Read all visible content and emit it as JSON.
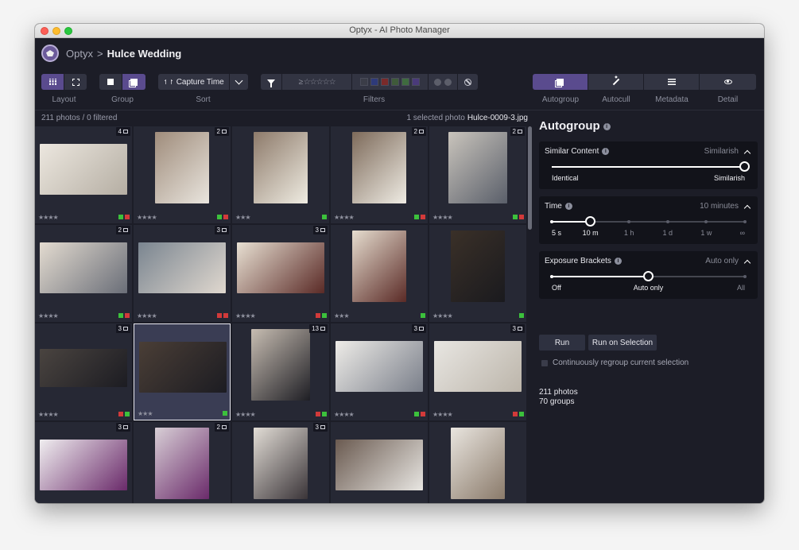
{
  "window": {
    "title": "Optyx - AI Photo Manager"
  },
  "breadcrumb": {
    "app": "Optyx",
    "separator": ">",
    "project": "Hulce Wedding"
  },
  "toolbar": {
    "layout_label": "Layout",
    "group_label": "Group",
    "sort_label": "Sort",
    "sort_value": "Capture Time",
    "sort_icon": "↿↾",
    "filters_label": "Filters",
    "filter_stars": "≥ ☆☆☆☆☆",
    "filter_colors": [
      "#3b3d48",
      "#2e3a7a",
      "#7a2a2a",
      "#3f5a3a",
      "#3f6b3f",
      "#4a3a7a"
    ],
    "autogroup_label": "Autogroup",
    "autocull_label": "Autocull",
    "metadata_label": "Metadata",
    "detail_label": "Detail"
  },
  "info": {
    "count": "211 photos / 0 filtered",
    "selected_prefix": "1 selected photo",
    "selected_file": "Hulce-0009-3.jpg"
  },
  "photos": [
    {
      "badge": "4",
      "stars": "★★★★",
      "flags": [
        "#3cc13c",
        "#d23a3a"
      ],
      "colors": [
        "#ece7df",
        "#b5aea3"
      ]
    },
    {
      "badge": "2",
      "stars": "★★★★",
      "flags": [
        "#3cc13c",
        "#d23a3a"
      ],
      "colors": [
        "#9f8c7b",
        "#e9e5de"
      ]
    },
    {
      "badge": "",
      "stars": "★★★",
      "flags": [
        "#3cc13c"
      ],
      "colors": [
        "#8d7a6a",
        "#efece2"
      ]
    },
    {
      "badge": "2",
      "stars": "★★★★",
      "flags": [
        "#3cc13c",
        "#d23a3a"
      ],
      "colors": [
        "#7d6a5a",
        "#efece4"
      ]
    },
    {
      "badge": "2",
      "stars": "★★★★",
      "flags": [
        "#3cc13c",
        "#d23a3a"
      ],
      "colors": [
        "#c9c4bc",
        "#5a5f6a"
      ]
    },
    {
      "badge": "2",
      "stars": "★★★★",
      "flags": [
        "#3cc13c",
        "#d23a3a"
      ],
      "colors": [
        "#e3dbd0",
        "#6a6e78"
      ]
    },
    {
      "badge": "3",
      "stars": "★★★★",
      "flags": [
        "#d23a3a",
        "#d23a3a"
      ],
      "colors": [
        "#7a8590",
        "#e0d8cf"
      ]
    },
    {
      "badge": "3",
      "stars": "★★★★",
      "flags": [
        "#d23a3a",
        "#3cc13c"
      ],
      "colors": [
        "#e8e0d3",
        "#5a2a26"
      ]
    },
    {
      "badge": "",
      "stars": "★★★",
      "flags": [
        "#3cc13c"
      ],
      "colors": [
        "#e6ddcf",
        "#5a2a26"
      ]
    },
    {
      "badge": "",
      "stars": "★★★★",
      "flags": [
        "#3cc13c"
      ],
      "colors": [
        "#3a3028",
        "#1a1a1e"
      ]
    },
    {
      "badge": "3",
      "stars": "★★★★",
      "flags": [
        "#d23a3a",
        "#3cc13c"
      ],
      "colors": [
        "#4a4440",
        "#1c1c22"
      ]
    },
    {
      "badge": "",
      "stars": "★★★",
      "flags": [
        "#3cc13c"
      ],
      "colors": [
        "#4a3e36",
        "#1c1c22"
      ]
    },
    {
      "badge": "13",
      "stars": "★★★★",
      "flags": [
        "#d23a3a",
        "#3cc13c"
      ],
      "colors": [
        "#c7bdb2",
        "#1e1e24"
      ]
    },
    {
      "badge": "3",
      "stars": "★★★★",
      "flags": [
        "#3cc13c",
        "#d23a3a"
      ],
      "colors": [
        "#eeece8",
        "#7a7f8a"
      ]
    },
    {
      "badge": "3",
      "stars": "★★★★",
      "flags": [
        "#d23a3a",
        "#3cc13c"
      ],
      "colors": [
        "#e8e6e2",
        "#bcb5aa"
      ]
    },
    {
      "badge": "3",
      "stars": "",
      "flags": [],
      "colors": [
        "#f0eef0",
        "#6a2a6a"
      ]
    },
    {
      "badge": "2",
      "stars": "",
      "flags": [],
      "colors": [
        "#d8cfd6",
        "#6a2a6a"
      ]
    },
    {
      "badge": "3",
      "stars": "",
      "flags": [],
      "colors": [
        "#e2ddd6",
        "#3a3438"
      ]
    },
    {
      "badge": "",
      "stars": "",
      "flags": [],
      "colors": [
        "#6a5a50",
        "#e8e6e2"
      ]
    },
    {
      "badge": "",
      "stars": "",
      "flags": [],
      "colors": [
        "#e9e5df",
        "#8a7a6a"
      ]
    }
  ],
  "selected_index": 11,
  "panel": {
    "title": "Autogroup",
    "similar": {
      "label": "Similar Content",
      "value": "Similarish",
      "left": "Identical",
      "right": "Similarish",
      "level": 1.0
    },
    "time": {
      "label": "Time",
      "value": "10 minutes",
      "ticks": [
        "5 s",
        "10 m",
        "1 h",
        "1 d",
        "1 w",
        "∞"
      ],
      "selected": 1
    },
    "exposure": {
      "label": "Exposure Brackets",
      "value": "Auto only",
      "ticks": [
        "Off",
        "Auto only",
        "All"
      ],
      "selected": 1
    },
    "run_label": "Run",
    "run_selection_label": "Run on Selection",
    "continuous_label": "Continuously regroup current selection",
    "stats_photos": "211 photos",
    "stats_groups": "70 groups"
  }
}
